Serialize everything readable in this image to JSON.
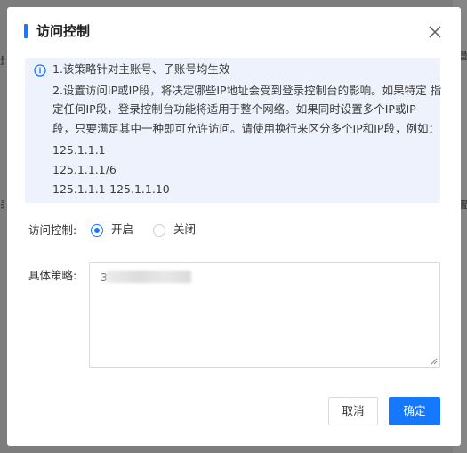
{
  "dialog": {
    "title": "访问控制",
    "notice": {
      "lines": [
        "1.该策略针对主账号、子账号均生效",
        "2.设置访问IP或IP段，将决定哪些IP地址会受到登录控制台的影响。如果特定 指",
        "定任何IP段，登录控制台功能将适用于整个网络。如果同时设置多个IP或IP",
        "段，只要满足其中一种即可允许访问。请使用换行来区分多个IP和IP段，例如：",
        "125.1.1.1",
        "125.1.1.1/6",
        "125.1.1.1-125.1.1.10"
      ]
    },
    "access_control": {
      "label": "访问控制:",
      "options": [
        "开启",
        "关闭"
      ],
      "selected": "开启"
    },
    "policy": {
      "label": "具体策略:",
      "value": "3"
    },
    "buttons": {
      "cancel": "取消",
      "confirm": "确定"
    }
  },
  "colors": {
    "primary": "#1677ff",
    "notice_bg": "#edf2fd",
    "overlay": "#7d7d7d"
  }
}
